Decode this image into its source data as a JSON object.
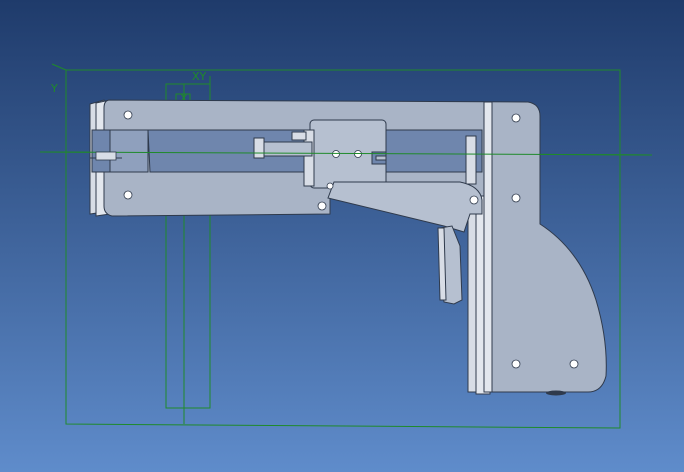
{
  "viewport": {
    "background_top": "#1f3b6b",
    "background_bottom": "#5f8ccb"
  },
  "sketch": {
    "color": "#1f8a2a",
    "plane_label_left": "Y",
    "plane_label_top": "XY",
    "plane_label_small": "X"
  },
  "part": {
    "face_color": "#a9b4c6",
    "edge_color": "#2f3a4c",
    "side_color": "#d8dde6",
    "shadow_color": "#7e8aa0"
  }
}
